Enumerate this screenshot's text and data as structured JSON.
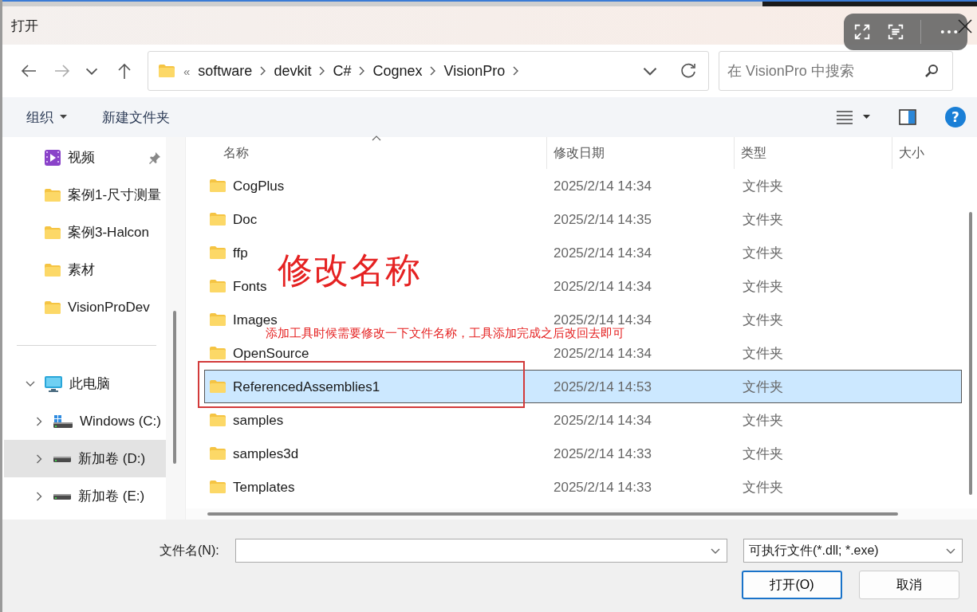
{
  "window": {
    "title": "打开"
  },
  "navigation": {
    "overflow": "«",
    "breadcrumb": [
      "software",
      "devkit",
      "C#",
      "Cognex",
      "VisionPro"
    ],
    "search": {
      "placeholder": "在 VisionPro 中搜索"
    }
  },
  "commands": {
    "items": [
      {
        "label": "组织",
        "kind": "menu"
      },
      {
        "label": "新建文件夹",
        "kind": "button"
      }
    ],
    "help": "?"
  },
  "sidebar": {
    "groups": [
      {
        "items": [
          {
            "label": "视频",
            "kind": "video",
            "pinned": true,
            "selected": false
          },
          {
            "label": "案例1-尺寸测量",
            "kind": "folder",
            "pinned": false,
            "selected": false
          },
          {
            "label": "案例3-Halcon",
            "kind": "folder",
            "pinned": false,
            "selected": false
          },
          {
            "label": "素材",
            "kind": "folder",
            "pinned": false,
            "selected": false
          },
          {
            "label": "VisionProDev",
            "kind": "folder",
            "pinned": false,
            "selected": false
          }
        ]
      },
      {
        "items": [
          {
            "label": "此电脑",
            "kind": "pc",
            "pinned": false,
            "selected": false,
            "expanded": true,
            "children": [
              {
                "label": "Windows (C:)",
                "kind": "system-drive",
                "pinned": false,
                "selected": false,
                "expanded": false
              },
              {
                "label": "新加卷 (D:)",
                "kind": "drive",
                "pinned": false,
                "selected": true,
                "expanded": false
              },
              {
                "label": "新加卷 (E:)",
                "kind": "drive",
                "pinned": false,
                "selected": false,
                "expanded": false
              }
            ]
          }
        ]
      }
    ]
  },
  "file_list": {
    "columns": [
      {
        "label": "名称",
        "sorted": true
      },
      {
        "label": "修改日期",
        "sorted": false
      },
      {
        "label": "类型",
        "sorted": false
      },
      {
        "label": "大小",
        "sorted": false
      }
    ],
    "rows": [
      {
        "name": "CogPlus",
        "modified": "2025/2/14 14:34",
        "type": "文件夹",
        "selected": false
      },
      {
        "name": "Doc",
        "modified": "2025/2/14 14:35",
        "type": "文件夹",
        "selected": false
      },
      {
        "name": "ffp",
        "modified": "2025/2/14 14:34",
        "type": "文件夹",
        "selected": false
      },
      {
        "name": "Fonts",
        "modified": "2025/2/14 14:34",
        "type": "文件夹",
        "selected": false
      },
      {
        "name": "Images",
        "modified": "2025/2/14 14:34",
        "type": "文件夹",
        "selected": false
      },
      {
        "name": "OpenSource",
        "modified": "2025/2/14 14:34",
        "type": "文件夹",
        "selected": false
      },
      {
        "name": "ReferencedAssemblies1",
        "modified": "2025/2/14 14:53",
        "type": "文件夹",
        "selected": true
      },
      {
        "name": "samples",
        "modified": "2025/2/14 14:34",
        "type": "文件夹",
        "selected": false
      },
      {
        "name": "samples3d",
        "modified": "2025/2/14 14:33",
        "type": "文件夹",
        "selected": false
      },
      {
        "name": "Templates",
        "modified": "2025/2/14 14:33",
        "type": "文件夹",
        "selected": false
      }
    ]
  },
  "annotations": {
    "heading": "修改名称",
    "note": "添加工具时候需要修改一下文件名称，工具添加完成之后改回去即可"
  },
  "footer": {
    "filename_label": "文件名(N):",
    "file_type": "可执行文件(*.dll; *.exe)",
    "buttons": [
      {
        "label": "打开(O)",
        "default": true
      },
      {
        "label": "取消",
        "default": false
      }
    ]
  }
}
